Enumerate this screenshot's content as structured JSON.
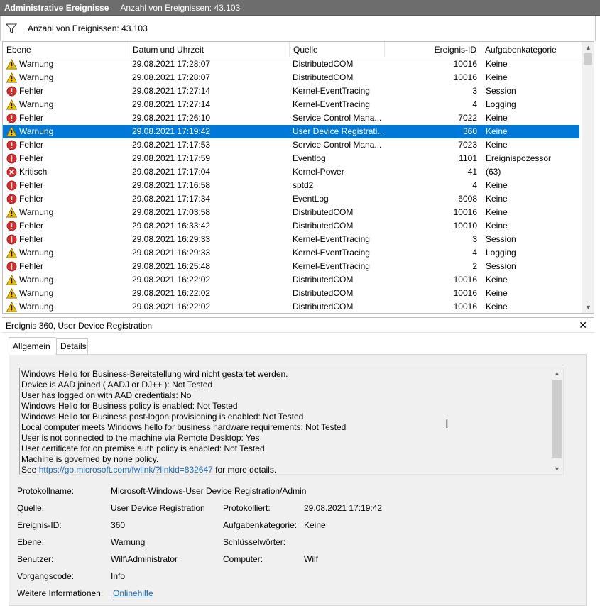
{
  "window": {
    "title": "Administrative Ereignisse",
    "event_count_label": "Anzahl von Ereignissen: 43.103"
  },
  "filterbar": {
    "icon": "filter-icon",
    "text": "Anzahl von Ereignissen: 43.103"
  },
  "grid": {
    "columns": [
      "Ebene",
      "Datum und Uhrzeit",
      "Quelle",
      "Ereignis-ID",
      "Aufgabenkategorie"
    ],
    "selected_index": 5,
    "rows": [
      {
        "level": "Warnung",
        "icon": "warning",
        "date": "29.08.2021 17:28:07",
        "source": "DistributedCOM",
        "id": "10016",
        "category": "Keine"
      },
      {
        "level": "Warnung",
        "icon": "warning",
        "date": "29.08.2021 17:28:07",
        "source": "DistributedCOM",
        "id": "10016",
        "category": "Keine"
      },
      {
        "level": "Fehler",
        "icon": "error",
        "date": "29.08.2021 17:27:14",
        "source": "Kernel-EventTracing",
        "id": "3",
        "category": "Session"
      },
      {
        "level": "Warnung",
        "icon": "warning",
        "date": "29.08.2021 17:27:14",
        "source": "Kernel-EventTracing",
        "id": "4",
        "category": "Logging"
      },
      {
        "level": "Fehler",
        "icon": "error",
        "date": "29.08.2021 17:26:10",
        "source": "Service Control Mana...",
        "id": "7022",
        "category": "Keine"
      },
      {
        "level": "Warnung",
        "icon": "warning",
        "date": "29.08.2021 17:19:42",
        "source": "User Device Registrati...",
        "id": "360",
        "category": "Keine"
      },
      {
        "level": "Fehler",
        "icon": "error",
        "date": "29.08.2021 17:17:53",
        "source": "Service Control Mana...",
        "id": "7023",
        "category": "Keine"
      },
      {
        "level": "Fehler",
        "icon": "error",
        "date": "29.08.2021 17:17:59",
        "source": "Eventlog",
        "id": "1101",
        "category": "Ereignispozessor"
      },
      {
        "level": "Kritisch",
        "icon": "critical",
        "date": "29.08.2021 17:17:04",
        "source": "Kernel-Power",
        "id": "41",
        "category": "(63)"
      },
      {
        "level": "Fehler",
        "icon": "error",
        "date": "29.08.2021 17:16:58",
        "source": "sptd2",
        "id": "4",
        "category": "Keine"
      },
      {
        "level": "Fehler",
        "icon": "error",
        "date": "29.08.2021 17:17:34",
        "source": "EventLog",
        "id": "6008",
        "category": "Keine"
      },
      {
        "level": "Warnung",
        "icon": "warning",
        "date": "29.08.2021 17:03:58",
        "source": "DistributedCOM",
        "id": "10016",
        "category": "Keine"
      },
      {
        "level": "Fehler",
        "icon": "error",
        "date": "29.08.2021 16:33:42",
        "source": "DistributedCOM",
        "id": "10010",
        "category": "Keine"
      },
      {
        "level": "Fehler",
        "icon": "error",
        "date": "29.08.2021 16:29:33",
        "source": "Kernel-EventTracing",
        "id": "3",
        "category": "Session"
      },
      {
        "level": "Warnung",
        "icon": "warning",
        "date": "29.08.2021 16:29:33",
        "source": "Kernel-EventTracing",
        "id": "4",
        "category": "Logging"
      },
      {
        "level": "Fehler",
        "icon": "error",
        "date": "29.08.2021 16:25:48",
        "source": "Kernel-EventTracing",
        "id": "2",
        "category": "Session"
      },
      {
        "level": "Warnung",
        "icon": "warning",
        "date": "29.08.2021 16:22:02",
        "source": "DistributedCOM",
        "id": "10016",
        "category": "Keine"
      },
      {
        "level": "Warnung",
        "icon": "warning",
        "date": "29.08.2021 16:22:02",
        "source": "DistributedCOM",
        "id": "10016",
        "category": "Keine"
      },
      {
        "level": "Warnung",
        "icon": "warning",
        "date": "29.08.2021 16:22:02",
        "source": "DistributedCOM",
        "id": "10016",
        "category": "Keine"
      }
    ]
  },
  "detail": {
    "title": "Ereignis 360, User Device Registration",
    "close_label": "✕",
    "tabs": [
      "Allgemein",
      "Details"
    ],
    "description_lines": [
      "Windows Hello for Business-Bereitstellung wird nicht gestartet werden.",
      "Device is AAD joined ( AADJ or DJ++ ): Not Tested",
      "User has logged on with AAD credentials: No",
      "Windows Hello for Business policy is enabled: Not Tested",
      "Windows Hello for Business post-logon provisioning is enabled: Not Tested",
      "Local computer meets Windows hello for business hardware requirements: Not Tested",
      "User is not connected to the machine via Remote Desktop: Yes",
      "User certificate for on premise auth policy is enabled: Not Tested",
      "Machine is governed by none policy."
    ],
    "see_prefix": "See ",
    "see_link": "https://go.microsoft.com/fwlink/?linkid=832647",
    "see_suffix": " for more details.",
    "props": {
      "protokollname_label": "Protokollname:",
      "protokollname_value": "Microsoft-Windows-User Device Registration/Admin",
      "quelle_label": "Quelle:",
      "quelle_value": "User Device Registration",
      "protokolliert_label": "Protokolliert:",
      "protokolliert_value": "29.08.2021 17:19:42",
      "ereignisid_label": "Ereignis-ID:",
      "ereignisid_value": "360",
      "aufgabenkategorie_label": "Aufgabenkategorie:",
      "aufgabenkategorie_value": "Keine",
      "ebene_label": "Ebene:",
      "ebene_value": "Warnung",
      "schluesselwoerter_label": "Schlüsselwörter:",
      "benutzer_label": "Benutzer:",
      "benutzer_value": "Wilf\\Administrator",
      "computer_label": "Computer:",
      "computer_value": "Wilf",
      "vorgangscode_label": "Vorgangscode:",
      "vorgangscode_value": "Info",
      "weitere_label": "Weitere Informationen:",
      "weitere_link": "Onlinehilfe"
    }
  },
  "colors": {
    "selection": "#0078d7",
    "warning": "#f2c200",
    "error": "#d32f2f",
    "link": "#1c69b7"
  }
}
